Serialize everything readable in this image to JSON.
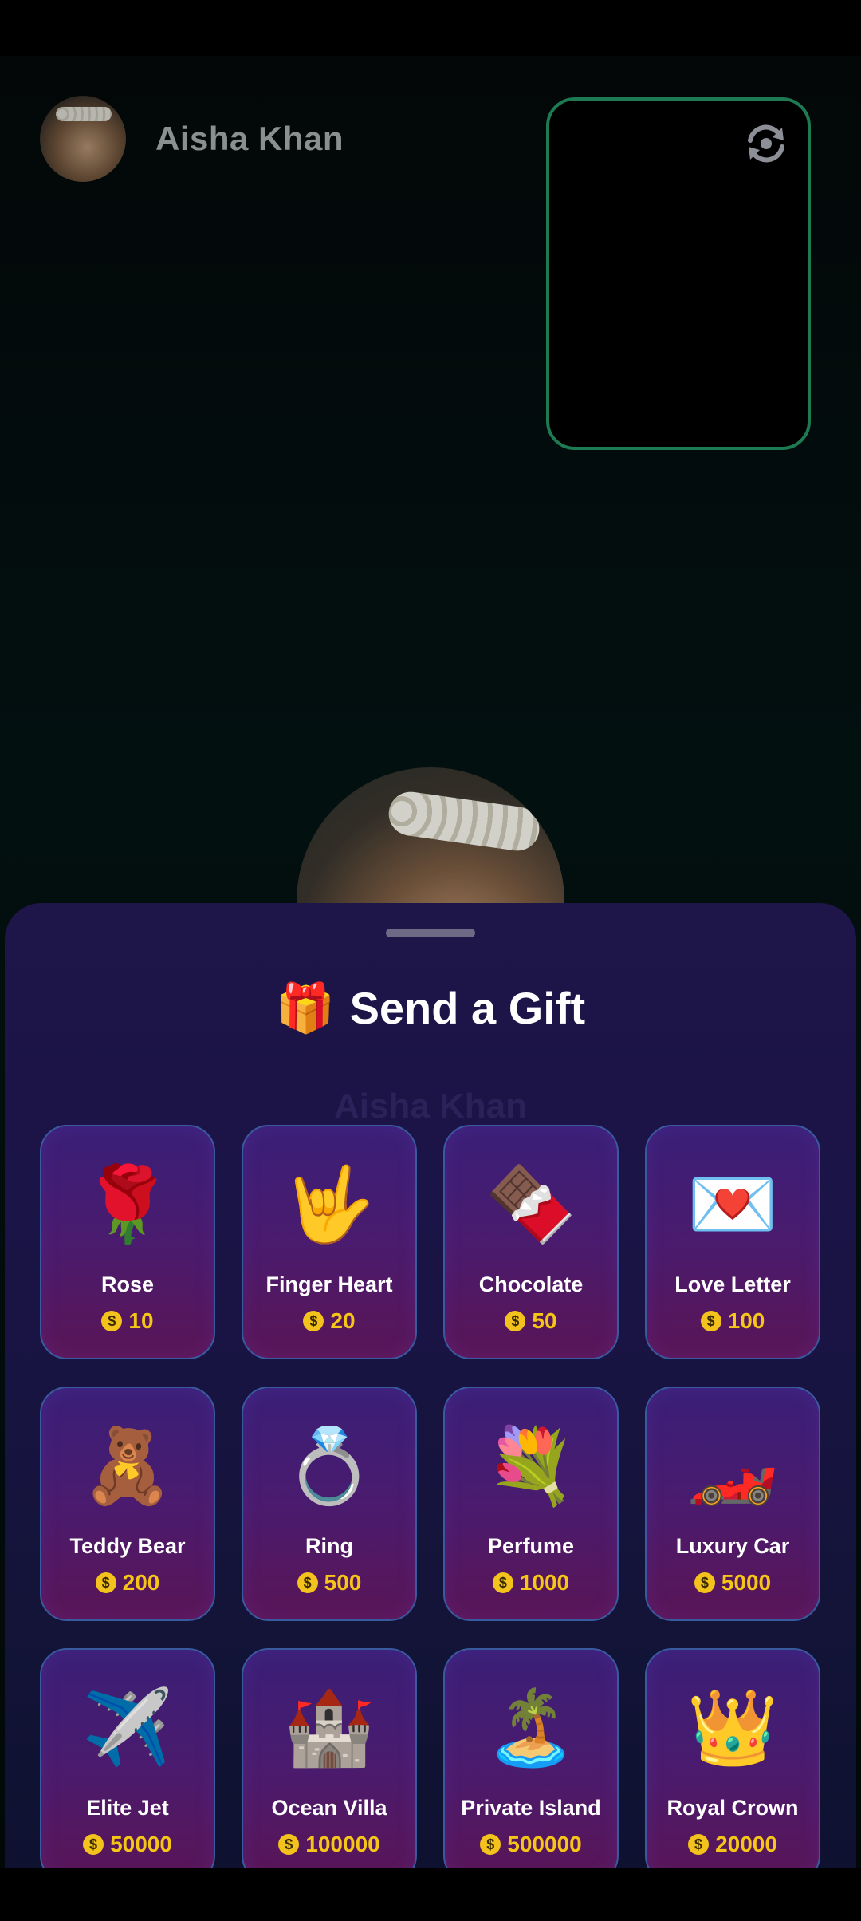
{
  "caller": {
    "name": "Aisha Khan"
  },
  "sheet": {
    "title": "Send a Gift",
    "title_icon": "🎁",
    "ghost_text": "Aisha Khan"
  },
  "gifts": [
    {
      "name": "Rose",
      "price": "10",
      "emoji": "🌹"
    },
    {
      "name": "Finger Heart",
      "price": "20",
      "emoji": "🤟"
    },
    {
      "name": "Chocolate",
      "price": "50",
      "emoji": "🍫"
    },
    {
      "name": "Love Letter",
      "price": "100",
      "emoji": "💌"
    },
    {
      "name": "Teddy Bear",
      "price": "200",
      "emoji": "🧸"
    },
    {
      "name": "Ring",
      "price": "500",
      "emoji": "💍"
    },
    {
      "name": "Perfume",
      "price": "1000",
      "emoji": "💐"
    },
    {
      "name": "Luxury Car",
      "price": "5000",
      "emoji": "🏎️"
    },
    {
      "name": "Elite Jet",
      "price": "50000",
      "emoji": "✈️"
    },
    {
      "name": "Ocean Villa",
      "price": "100000",
      "emoji": "🏰"
    },
    {
      "name": "Private Island",
      "price": "500000",
      "emoji": "🏝️"
    },
    {
      "name": "Royal Crown",
      "price": "20000",
      "emoji": "👑"
    }
  ],
  "icons": {
    "switch_camera": "switch-camera-icon",
    "coin": "coin-icon"
  },
  "colors": {
    "preview_border": "#1e7a52",
    "price": "#f5c518",
    "sheet": "#1e1548"
  }
}
